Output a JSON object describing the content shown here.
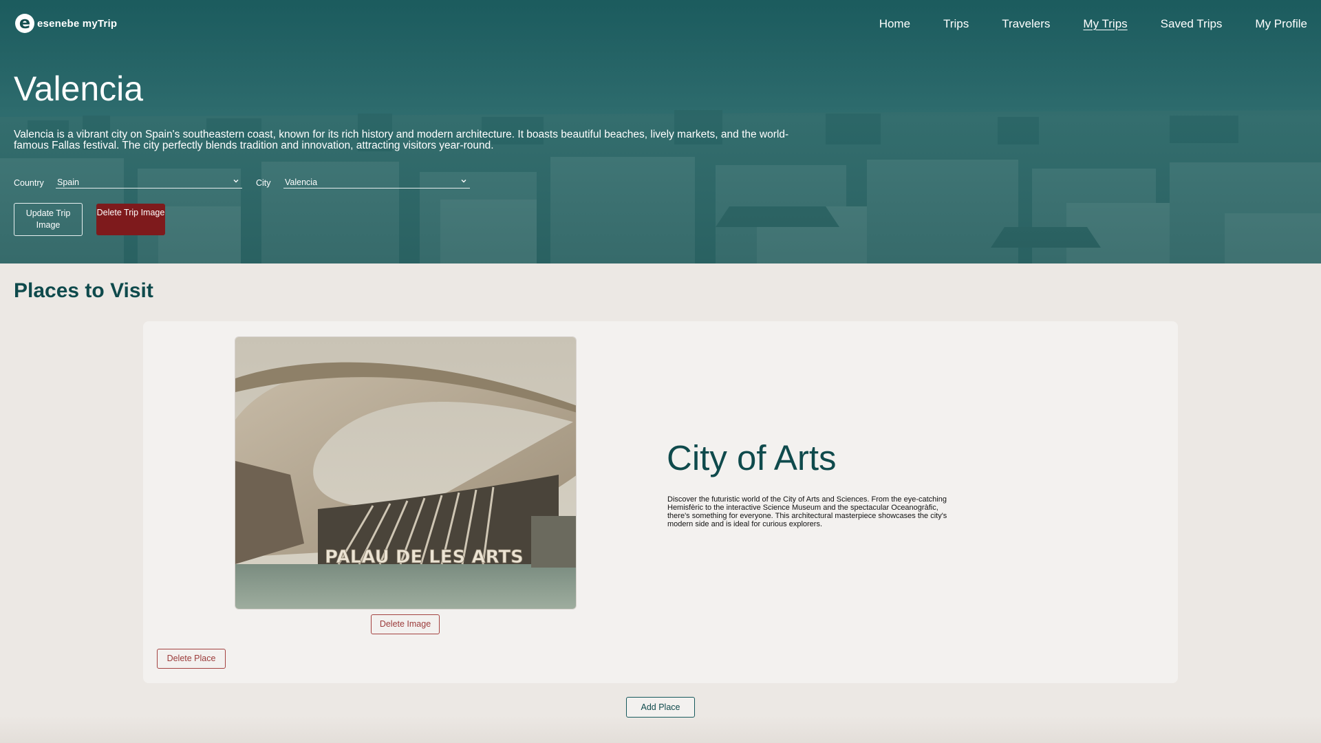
{
  "brand": {
    "logo_letter": "e",
    "name": "esenebe myTrip"
  },
  "nav": {
    "items": [
      {
        "label": "Home",
        "active": false
      },
      {
        "label": "Trips",
        "active": false
      },
      {
        "label": "Travelers",
        "active": false
      },
      {
        "label": "My Trips",
        "active": true
      },
      {
        "label": "Saved Trips",
        "active": false
      },
      {
        "label": "My Profile",
        "active": false
      }
    ]
  },
  "trip": {
    "title": "Valencia",
    "description": "Valencia is a vibrant city on Spain's southeastern coast, known for its rich history and modern architecture. It boasts beautiful beaches, lively markets, and the world-famous Fallas festival. The city perfectly blends tradition and innovation, attracting visitors year-round.",
    "country_label": "Country",
    "country_value": "Spain",
    "city_label": "City",
    "city_value": "Valencia",
    "update_image_label": "Update Trip Image",
    "delete_image_label": "Delete Trip Image"
  },
  "places": {
    "section_title": "Places to Visit",
    "items": [
      {
        "title": "City of Arts",
        "description": "Discover the futuristic world of the City of Arts and Sciences. From the eye-catching Hemisfèric to the interactive Science Museum and the spectacular Oceanogràfic, there's something for everyone. This architectural masterpiece showcases the city's modern side and is ideal for curious explorers.",
        "image_sign_text": "PALAU DE LES ARTS",
        "delete_image_label": "Delete Image",
        "delete_place_label": "Delete Place"
      }
    ],
    "add_place_label": "Add Place"
  },
  "colors": {
    "primary_teal": "#0f4a4c",
    "danger": "#7e1a1c",
    "page_bg": "#ece8e4",
    "card_bg": "#f3f1ef"
  },
  "icons": {
    "select_arrow": "chevron-down-icon"
  }
}
